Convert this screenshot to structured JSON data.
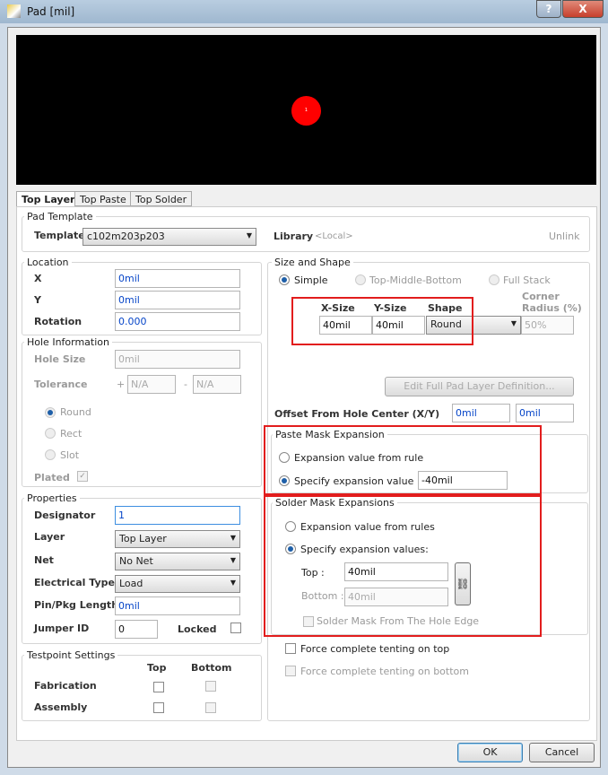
{
  "window": {
    "title": "Pad [mil]",
    "help": "?",
    "close": "X"
  },
  "preview": {
    "pad_label": "1",
    "pad_color": "#ff0000"
  },
  "tabs": [
    "Top Layer",
    "Top Paste",
    "Top Solder"
  ],
  "pad_template": {
    "group": "Pad Template",
    "template_label": "Template",
    "template_value": "c102m203p203",
    "library_label": "Library",
    "library_value": "<Local>",
    "unlink": "Unlink"
  },
  "location": {
    "group": "Location",
    "x_label": "X",
    "x": "0mil",
    "y_label": "Y",
    "y": "0mil",
    "rotation_label": "Rotation",
    "rotation": "0.000"
  },
  "hole": {
    "group": "Hole Information",
    "size_label": "Hole Size",
    "size": "0mil",
    "tol_label": "Tolerance",
    "plus": "+",
    "minus": "-",
    "tol_plus": "N/A",
    "tol_minus": "N/A",
    "round": "Round",
    "rect": "Rect",
    "slot": "Slot",
    "plated": "Plated"
  },
  "properties": {
    "group": "Properties",
    "designator_label": "Designator",
    "designator": "1",
    "layer_label": "Layer",
    "layer": "Top Layer",
    "net_label": "Net",
    "net": "No Net",
    "etype_label": "Electrical Type",
    "etype": "Load",
    "pinlen_label": "Pin/Pkg Length",
    "pinlen": "0mil",
    "jumper_label": "Jumper ID",
    "jumper": "0",
    "locked_label": "Locked"
  },
  "testpoint": {
    "group": "Testpoint Settings",
    "top": "Top",
    "bottom": "Bottom",
    "fabrication": "Fabrication",
    "assembly": "Assembly"
  },
  "size_shape": {
    "group": "Size and Shape",
    "simple": "Simple",
    "tmb": "Top-Middle-Bottom",
    "full": "Full Stack",
    "xsize_label": "X-Size",
    "ysize_label": "Y-Size",
    "shape_label": "Shape",
    "corner_label1": "Corner",
    "corner_label2": "Radius (%)",
    "xsize": "40mil",
    "ysize": "40mil",
    "shape": "Round",
    "corner": "50%",
    "edit_button": "Edit Full Pad Layer Definition...",
    "offset_label": "Offset From Hole Center (X/Y)",
    "offset_x": "0mil",
    "offset_y": "0mil"
  },
  "paste": {
    "group": "Paste Mask Expansion",
    "from_rule": "Expansion value from rule",
    "specify": "Specify expansion value",
    "value": "-40mil"
  },
  "solder": {
    "group": "Solder Mask Expansions",
    "from_rules": "Expansion value from rules",
    "specify": "Specify expansion values:",
    "top_label": "Top :",
    "top": "40mil",
    "bottom_label": "Bottom :",
    "bottom": "40mil",
    "from_hole": "Solder Mask From The Hole Edge"
  },
  "tenting": {
    "top": "Force complete tenting on top",
    "bottom": "Force complete tenting on bottom"
  },
  "footer": {
    "ok": "OK",
    "cancel": "Cancel"
  }
}
